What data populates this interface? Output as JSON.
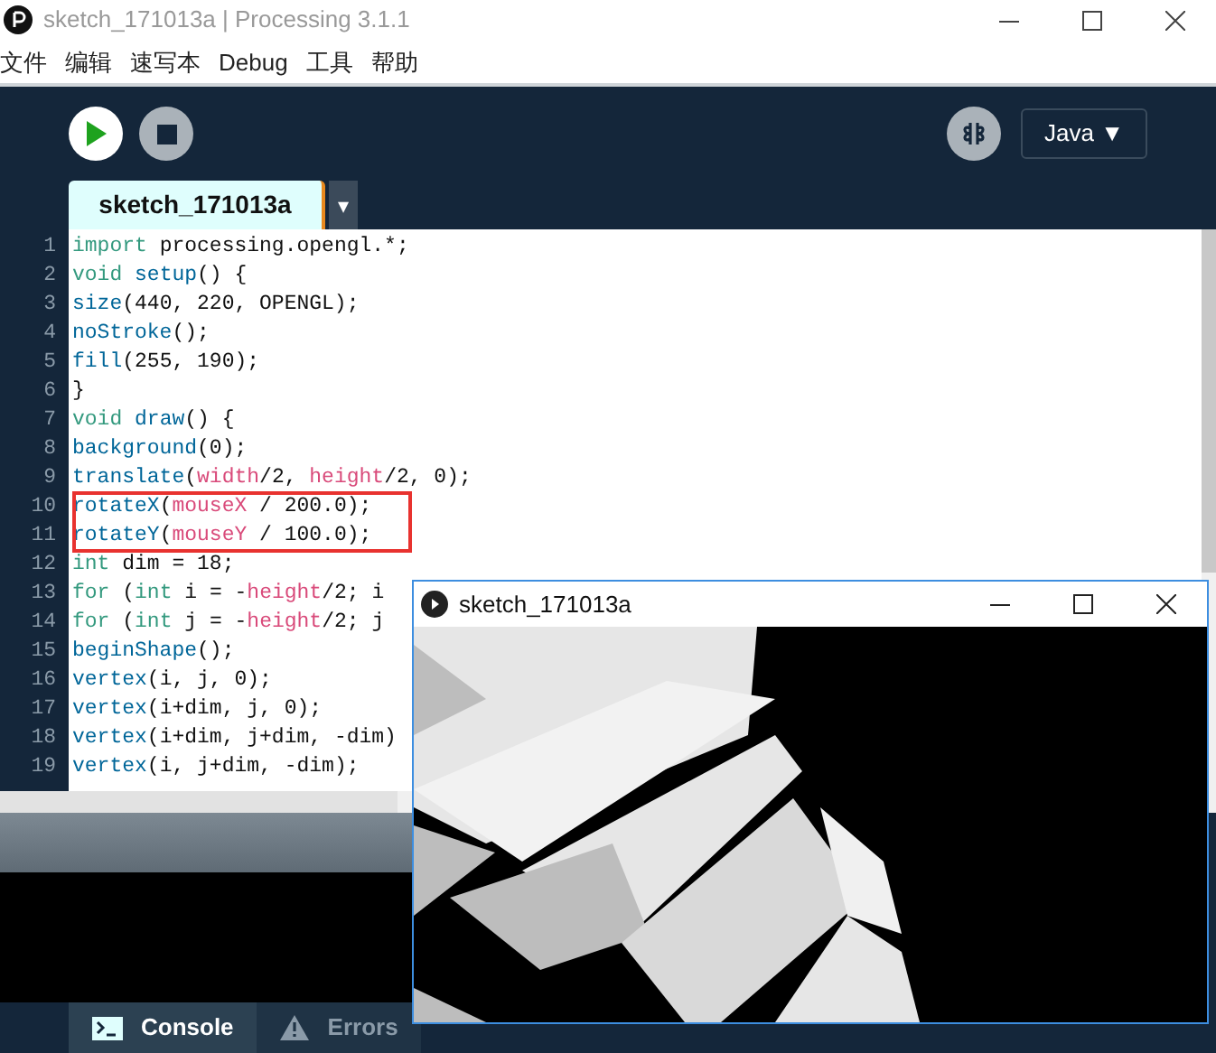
{
  "window": {
    "title": "sketch_171013a | Processing 3.1.1"
  },
  "menu": [
    "文件",
    "编辑",
    "速写本",
    "Debug",
    "工具",
    "帮助"
  ],
  "toolbar": {
    "mode": "Java ▼"
  },
  "editor_tab": {
    "label": "sketch_171013a",
    "menu_arrow": "▾"
  },
  "code": [
    {
      "number": "1",
      "annotated": false,
      "tokens": [
        {
          "kind": "keyword",
          "text": "import"
        },
        {
          "kind": "plain",
          "text": " processing.opengl.*;"
        }
      ]
    },
    {
      "number": "2",
      "annotated": false,
      "tokens": [
        {
          "kind": "keyword",
          "text": "void "
        },
        {
          "kind": "function",
          "text": "setup"
        },
        {
          "kind": "plain",
          "text": "() {"
        }
      ]
    },
    {
      "number": "3",
      "annotated": false,
      "tokens": [
        {
          "kind": "function",
          "text": "size"
        },
        {
          "kind": "plain",
          "text": "(440, 220, OPENGL);"
        }
      ]
    },
    {
      "number": "4",
      "annotated": false,
      "tokens": [
        {
          "kind": "function",
          "text": "noStroke"
        },
        {
          "kind": "plain",
          "text": "();"
        }
      ]
    },
    {
      "number": "5",
      "annotated": false,
      "tokens": [
        {
          "kind": "function",
          "text": "fill"
        },
        {
          "kind": "plain",
          "text": "(255, 190);"
        }
      ]
    },
    {
      "number": "6",
      "annotated": false,
      "tokens": [
        {
          "kind": "plain",
          "text": "}"
        }
      ]
    },
    {
      "number": "7",
      "annotated": false,
      "tokens": [
        {
          "kind": "keyword",
          "text": "void "
        },
        {
          "kind": "function",
          "text": "draw"
        },
        {
          "kind": "plain",
          "text": "() {"
        }
      ]
    },
    {
      "number": "8",
      "annotated": false,
      "tokens": [
        {
          "kind": "function",
          "text": "background"
        },
        {
          "kind": "plain",
          "text": "(0);"
        }
      ]
    },
    {
      "number": "9",
      "annotated": false,
      "tokens": [
        {
          "kind": "function",
          "text": "translate"
        },
        {
          "kind": "plain",
          "text": "("
        },
        {
          "kind": "variable",
          "text": "width"
        },
        {
          "kind": "plain",
          "text": "/2, "
        },
        {
          "kind": "variable",
          "text": "height"
        },
        {
          "kind": "plain",
          "text": "/2, 0);"
        }
      ]
    },
    {
      "number": "10",
      "annotated": true,
      "tokens": [
        {
          "kind": "function",
          "text": "rotateX"
        },
        {
          "kind": "plain",
          "text": "("
        },
        {
          "kind": "variable",
          "text": "mouseX"
        },
        {
          "kind": "plain",
          "text": " / 200.0);"
        }
      ]
    },
    {
      "number": "11",
      "annotated": true,
      "tokens": [
        {
          "kind": "function",
          "text": "rotateY"
        },
        {
          "kind": "plain",
          "text": "("
        },
        {
          "kind": "variable",
          "text": "mouseY"
        },
        {
          "kind": "plain",
          "text": " / 100.0);"
        }
      ]
    },
    {
      "number": "12",
      "annotated": false,
      "tokens": [
        {
          "kind": "keyword",
          "text": "int"
        },
        {
          "kind": "plain",
          "text": " dim = 18;"
        }
      ]
    },
    {
      "number": "13",
      "annotated": false,
      "tokens": [
        {
          "kind": "keyword",
          "text": "for"
        },
        {
          "kind": "plain",
          "text": " ("
        },
        {
          "kind": "keyword",
          "text": "int"
        },
        {
          "kind": "plain",
          "text": " i = -"
        },
        {
          "kind": "variable",
          "text": "height"
        },
        {
          "kind": "plain",
          "text": "/2; i"
        }
      ]
    },
    {
      "number": "14",
      "annotated": false,
      "tokens": [
        {
          "kind": "keyword",
          "text": "for"
        },
        {
          "kind": "plain",
          "text": " ("
        },
        {
          "kind": "keyword",
          "text": "int"
        },
        {
          "kind": "plain",
          "text": " j = -"
        },
        {
          "kind": "variable",
          "text": "height"
        },
        {
          "kind": "plain",
          "text": "/2; j"
        }
      ]
    },
    {
      "number": "15",
      "annotated": false,
      "tokens": [
        {
          "kind": "function",
          "text": "beginShape"
        },
        {
          "kind": "plain",
          "text": "();"
        }
      ]
    },
    {
      "number": "16",
      "annotated": false,
      "tokens": [
        {
          "kind": "function",
          "text": "vertex"
        },
        {
          "kind": "plain",
          "text": "(i, j, 0);"
        }
      ]
    },
    {
      "number": "17",
      "annotated": false,
      "tokens": [
        {
          "kind": "function",
          "text": "vertex"
        },
        {
          "kind": "plain",
          "text": "(i+dim, j, 0);"
        }
      ]
    },
    {
      "number": "18",
      "annotated": false,
      "tokens": [
        {
          "kind": "function",
          "text": "vertex"
        },
        {
          "kind": "plain",
          "text": "(i+dim, j+dim, -dim)"
        }
      ]
    },
    {
      "number": "19",
      "annotated": false,
      "tokens": [
        {
          "kind": "function",
          "text": "vertex"
        },
        {
          "kind": "plain",
          "text": "(i, j+dim, -dim);"
        }
      ]
    }
  ],
  "bottom_tabs": [
    {
      "label": "Console",
      "selected": true
    },
    {
      "label": "Errors",
      "selected": false
    }
  ],
  "sketch_window": {
    "title": "sketch_171013a"
  }
}
